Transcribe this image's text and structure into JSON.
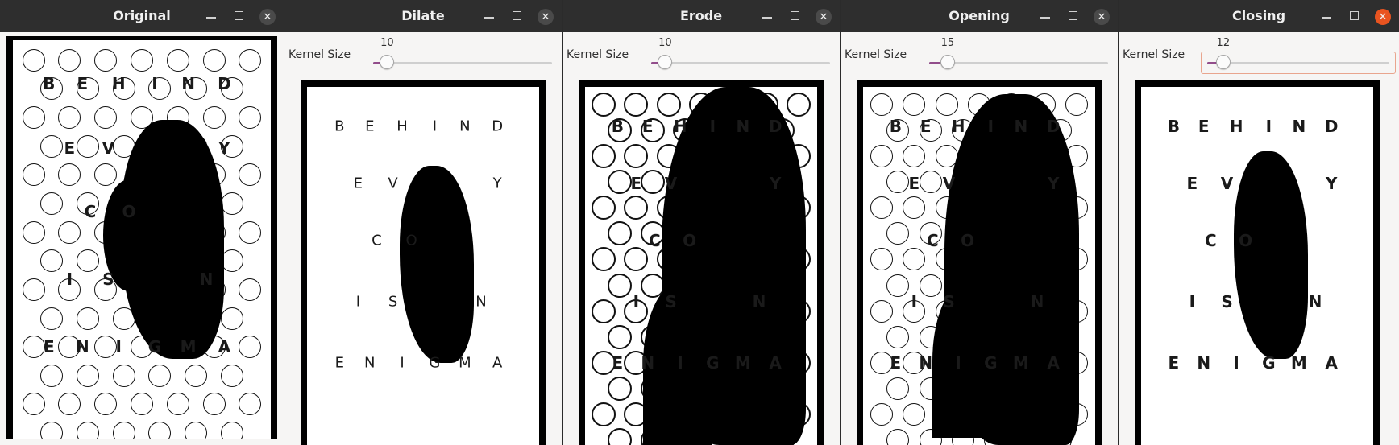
{
  "colors": {
    "accent": "#924d8b",
    "close_active": "#e95420",
    "titlebar": "#2e2e2e"
  },
  "windows": [
    {
      "title": "Original",
      "has_slider": false,
      "close_active": false
    },
    {
      "title": "Dilate",
      "has_slider": true,
      "slider_label": "Kernel Size",
      "slider_value": "10",
      "slider_fraction": 0.05,
      "close_active": false
    },
    {
      "title": "Erode",
      "has_slider": true,
      "slider_label": "Kernel Size",
      "slider_value": "10",
      "slider_fraction": 0.05,
      "close_active": false
    },
    {
      "title": "Opening",
      "has_slider": true,
      "slider_label": "Kernel Size",
      "slider_value": "15",
      "slider_fraction": 0.075,
      "close_active": false
    },
    {
      "title": "Closing",
      "has_slider": true,
      "slider_label": "Kernel Size",
      "slider_value": "12",
      "slider_fraction": 0.06,
      "close_active": true
    }
  ],
  "poster": {
    "rows": [
      [
        "B",
        "E",
        "H",
        "I",
        "N",
        "D"
      ],
      [
        "E",
        "V",
        "Y"
      ],
      [
        "C",
        "O"
      ],
      [
        "I",
        "S",
        "N"
      ],
      [
        "E",
        "N",
        "I",
        "G",
        "M",
        "A"
      ]
    ],
    "variants": [
      "original",
      "dilate",
      "erode",
      "opening",
      "closing"
    ]
  }
}
